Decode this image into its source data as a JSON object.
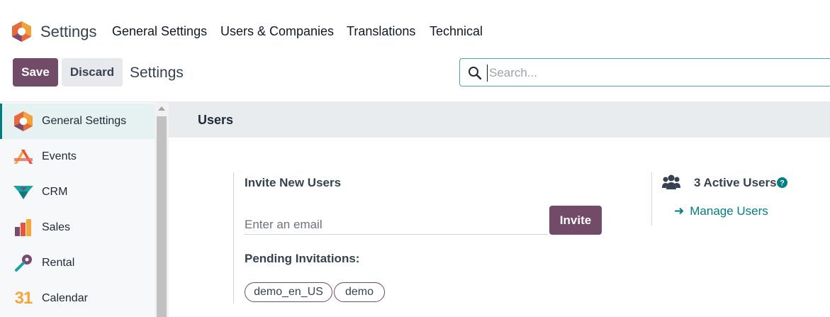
{
  "topnav": {
    "app_name": "Settings",
    "menu": [
      "General Settings",
      "Users & Companies",
      "Translations",
      "Technical"
    ]
  },
  "control_panel": {
    "save_label": "Save",
    "discard_label": "Discard",
    "breadcrumb": "Settings",
    "search_placeholder": "Search..."
  },
  "sidebar": {
    "items": [
      {
        "label": "General Settings",
        "icon": "settings-icon",
        "active": true
      },
      {
        "label": "Events",
        "icon": "events-icon"
      },
      {
        "label": "CRM",
        "icon": "crm-icon"
      },
      {
        "label": "Sales",
        "icon": "sales-icon"
      },
      {
        "label": "Rental",
        "icon": "rental-icon"
      },
      {
        "label": "Calendar",
        "icon": "calendar-icon",
        "icon_text": "31"
      }
    ]
  },
  "section": {
    "title": "Users",
    "invite_title": "Invite New Users",
    "email_placeholder": "Enter an email",
    "invite_label": "Invite",
    "pending_title": "Pending Invitations:",
    "pending": [
      "demo_en_US",
      "demo"
    ],
    "active_users": "3 Active Users",
    "manage_users": "Manage Users"
  },
  "colors": {
    "brand": "#714b67",
    "accent": "#017e84"
  }
}
